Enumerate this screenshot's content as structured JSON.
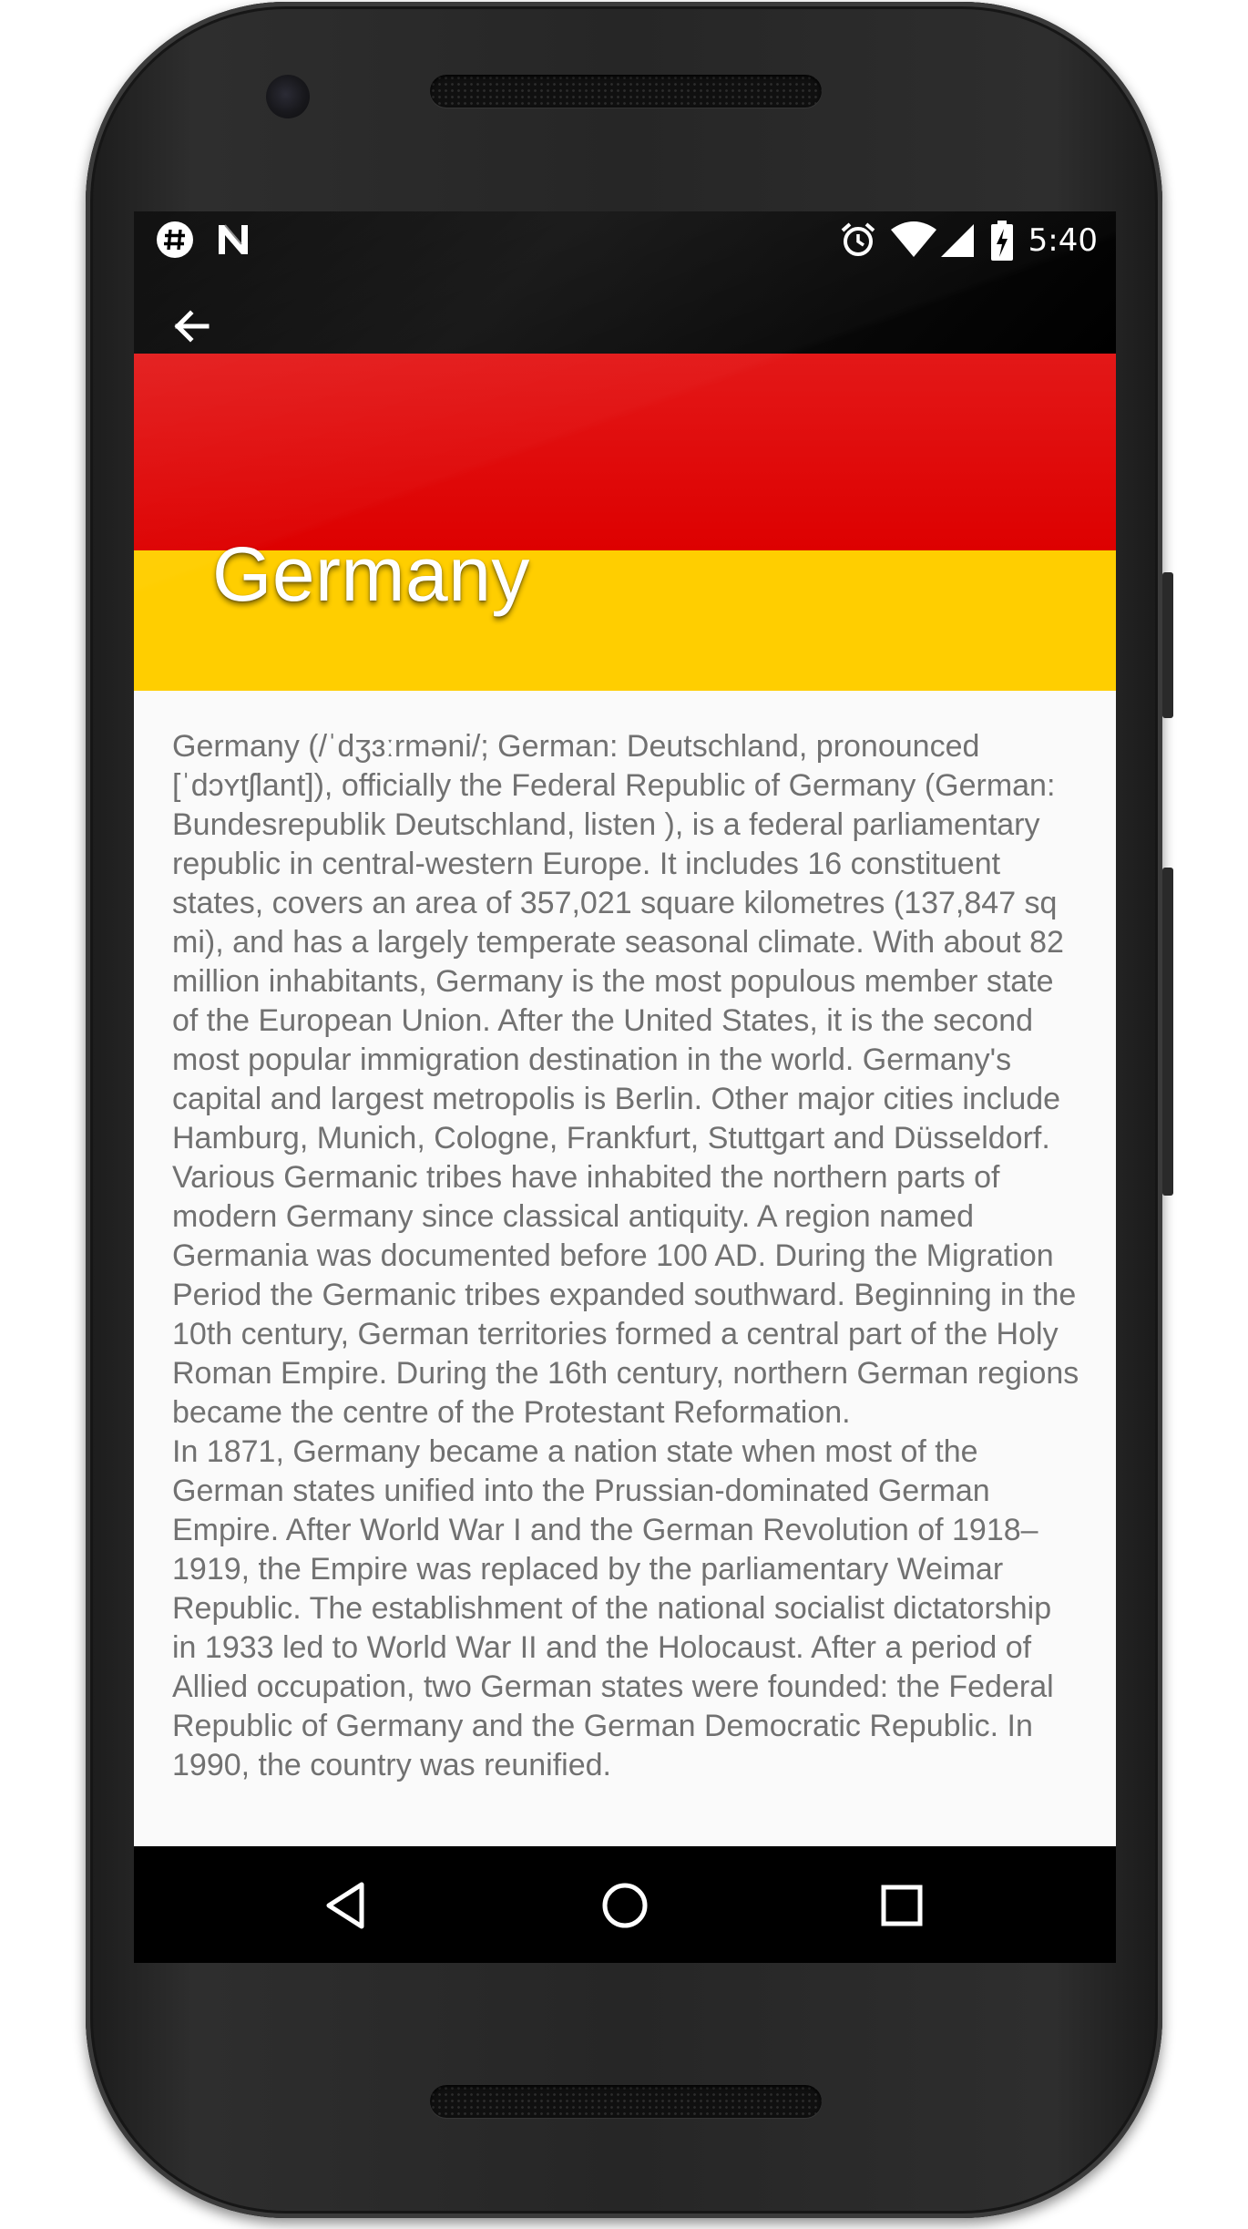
{
  "device": {
    "frame_color": "#262626"
  },
  "status_bar": {
    "left_icons": [
      "hashtag-notification-icon",
      "n-notification-icon"
    ],
    "right_icons": [
      "alarm-icon",
      "wifi-icon",
      "cell-signal-icon",
      "battery-charging-icon"
    ],
    "time": "5:40"
  },
  "header": {
    "back_icon": "arrow-back-icon",
    "title": "Germany",
    "flag_colors": [
      "#000000",
      "#dd0000",
      "#ffce00"
    ]
  },
  "article": {
    "paragraphs": [
      "Germany (/ˈdʒɜːrməni/; German: Deutschland, pronounced [ˈdɔʏtʃlant]), officially the Federal Republic of Germany (German: Bundesrepublik Deutschland,  listen ), is a federal parliamentary republic in central-western Europe. It includes 16 constituent states, covers an area of 357,021 square kilometres (137,847 sq mi), and has a largely temperate seasonal climate. With about 82 million inhabitants, Germany is the most populous member state of the European Union. After the United States, it is the second most popular immigration destination in the world. Germany's capital and largest metropolis is Berlin. Other major cities include Hamburg, Munich, Cologne, Frankfurt, Stuttgart and Düsseldorf.",
      "Various Germanic tribes have inhabited the northern parts of modern Germany since classical antiquity. A region named Germania was documented before 100 AD. During the Migration Period the Germanic tribes expanded southward. Beginning in the 10th century, German territories formed a central part of the Holy Roman Empire. During the 16th century, northern German regions became the centre of the Protestant Reformation.",
      "In 1871, Germany became a nation state when most of the German states unified into the Prussian-dominated German Empire. After World War I and the German Revolution of 1918–1919, the Empire was replaced by the parliamentary Weimar Republic. The establishment of the national socialist dictatorship in 1933 led to World War II and the Holocaust. After a period of Allied occupation, two German states were founded: the Federal Republic of Germany and the German Democratic Republic. In 1990, the country was reunified."
    ],
    "text_color": "#717171",
    "background": "#fafafa"
  },
  "nav_bar": {
    "buttons": [
      "nav-back-icon",
      "nav-home-icon",
      "nav-recents-icon"
    ]
  }
}
